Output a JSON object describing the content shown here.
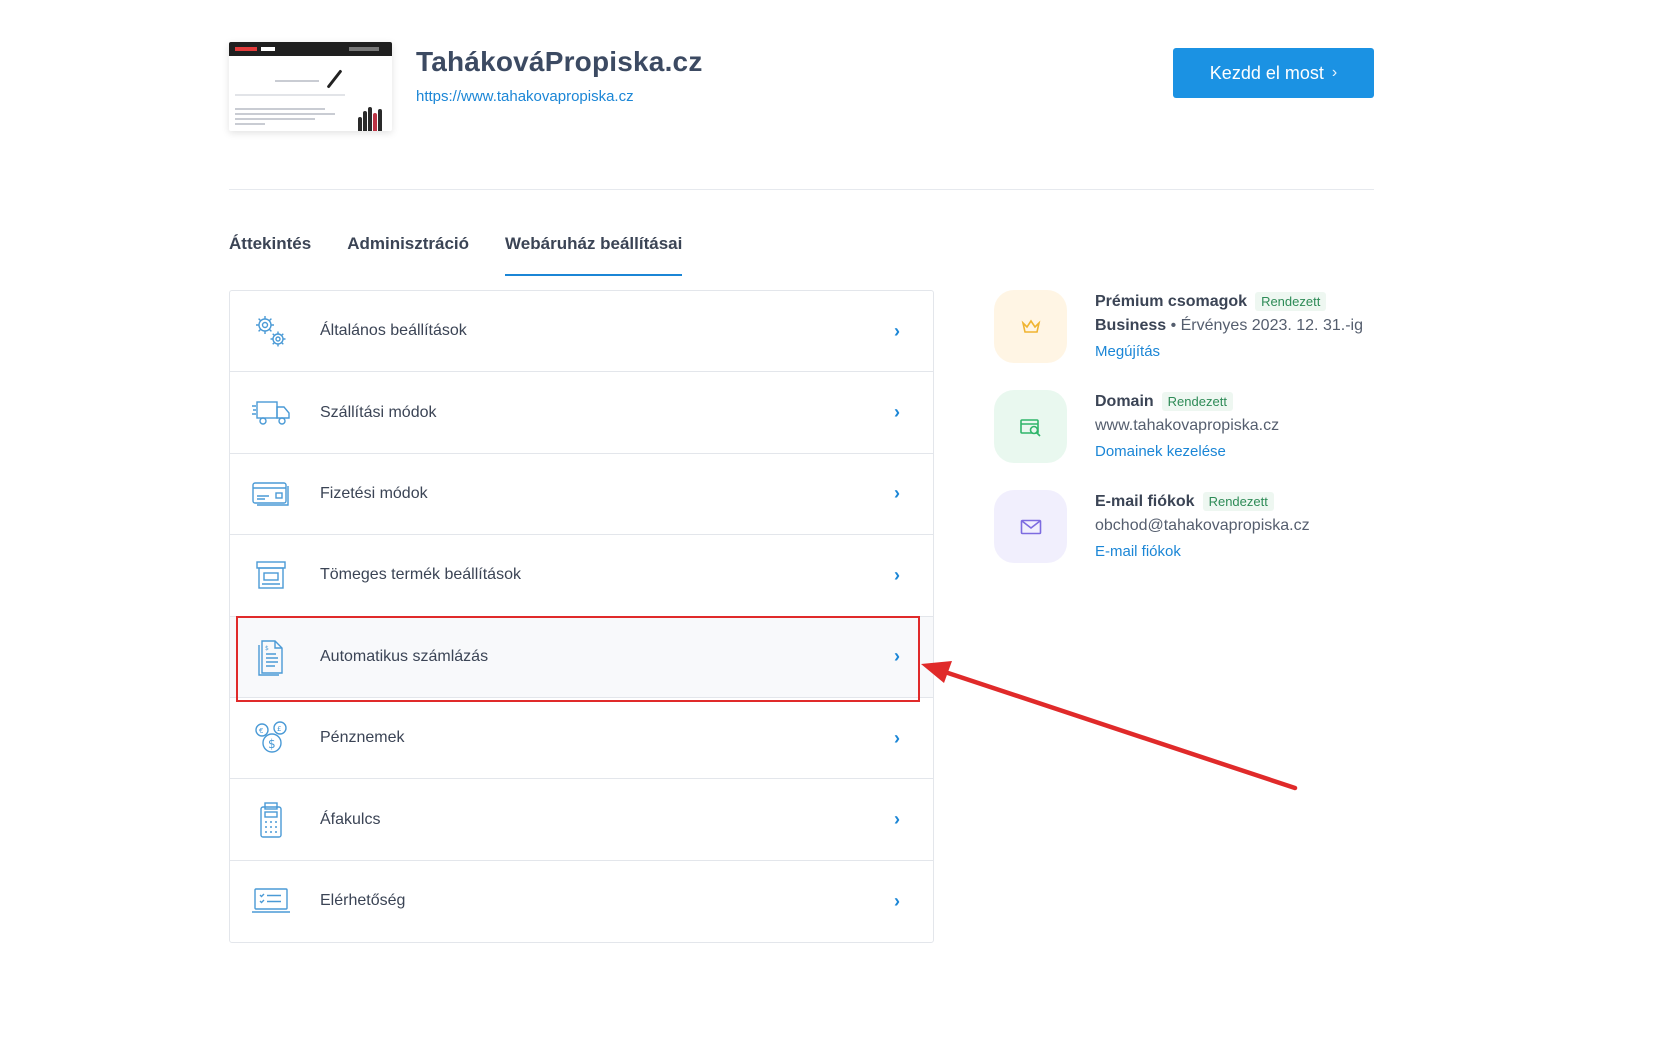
{
  "header": {
    "site_title": "TahákováPropiska.cz",
    "site_url": "https://www.tahakovapropiska.cz",
    "cta_label": "Kezdd el most"
  },
  "tabs": [
    {
      "label": "Áttekintés",
      "active": false
    },
    {
      "label": "Adminisztráció",
      "active": false
    },
    {
      "label": "Webáruház beállításai",
      "active": true
    }
  ],
  "settings_list": [
    {
      "label": "Általános beállítások",
      "icon": "gears-icon"
    },
    {
      "label": "Szállítási módok",
      "icon": "truck-icon"
    },
    {
      "label": "Fizetési módok",
      "icon": "credit-card-icon"
    },
    {
      "label": "Tömeges termék beállítások",
      "icon": "box-icon"
    },
    {
      "label": "Automatikus számlázás",
      "icon": "invoice-icon",
      "highlighted": true
    },
    {
      "label": "Pénznemek",
      "icon": "currency-coins-icon"
    },
    {
      "label": "Áfakulcs",
      "icon": "calculator-icon"
    },
    {
      "label": "Elérhetőség",
      "icon": "laptop-checklist-icon"
    }
  ],
  "sidebar": {
    "premium": {
      "title": "Prémium csomagok",
      "badge": "Rendezett",
      "plan": "Business",
      "validity": " • Érvényes 2023. 12. 31.-ig",
      "link": "Megújítás",
      "icon": "crown-icon",
      "color": "#f0b430"
    },
    "domain": {
      "title": "Domain",
      "badge": "Rendezett",
      "value": "www.tahakovapropiska.cz",
      "link": "Domainek kezelése",
      "icon": "domain-search-icon",
      "color": "#2fb56a"
    },
    "email": {
      "title": "E-mail fiókok",
      "badge": "Rendezett",
      "value": "obchod@tahakovapropiska.cz",
      "link": "E-mail fiókok",
      "icon": "envelope-icon",
      "color": "#7d6be0"
    }
  },
  "colors": {
    "accent": "#1b86d6",
    "annotation": "#e02a2a"
  }
}
